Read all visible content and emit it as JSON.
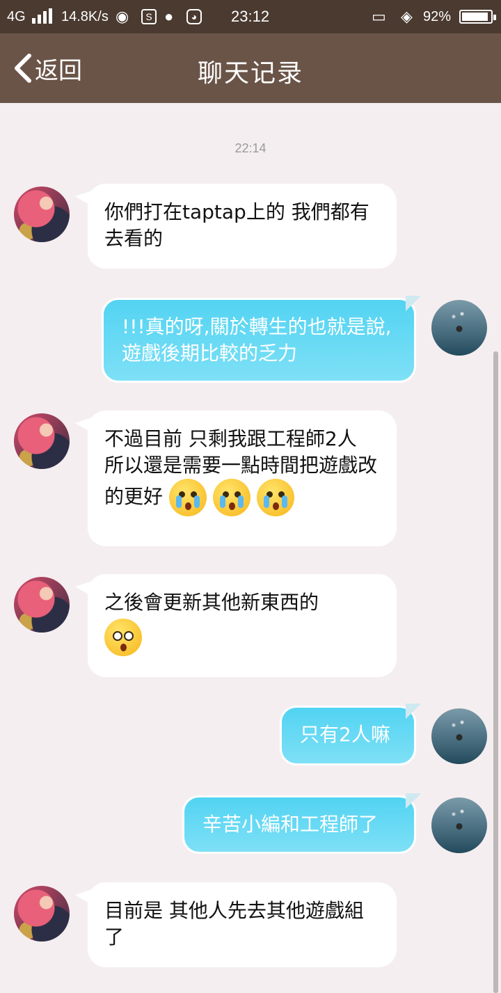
{
  "status_bar": {
    "network": "4G",
    "speed": "14.8K/s",
    "time": "23:12",
    "battery_percent_label": "92%",
    "battery_level": 0.92
  },
  "header": {
    "back_label": "返回",
    "title": "聊天记录"
  },
  "timestamp": "22:14",
  "messages": [
    {
      "side": "left",
      "text": "你們打在taptap上的 我們都有去看的"
    },
    {
      "side": "right",
      "text": "!!!真的呀,關於轉生的也就是說,遊戲後期比較的乏力"
    },
    {
      "side": "left",
      "text": "不過目前 只剩我跟工程師2人 所以還是需要一點時間把遊戲改的更好",
      "emojis": [
        "crying-face-icon",
        "crying-face-icon",
        "crying-face-icon"
      ]
    },
    {
      "side": "left",
      "text": "之後會更新其他新東西的",
      "emojis": [
        "surprised-face-icon"
      ]
    },
    {
      "side": "right",
      "text": "只有2人嘛"
    },
    {
      "side": "right",
      "text": "辛苦小編和工程師了"
    },
    {
      "side": "left",
      "text": "目前是 其他人先去其他遊戲組了"
    }
  ],
  "colors": {
    "status_bar_bg": "#4a3a30",
    "header_bg": "#6a5448",
    "page_bg": "#f5eef0",
    "bubble_right": "#52d3f2",
    "bubble_left": "#ffffff"
  }
}
